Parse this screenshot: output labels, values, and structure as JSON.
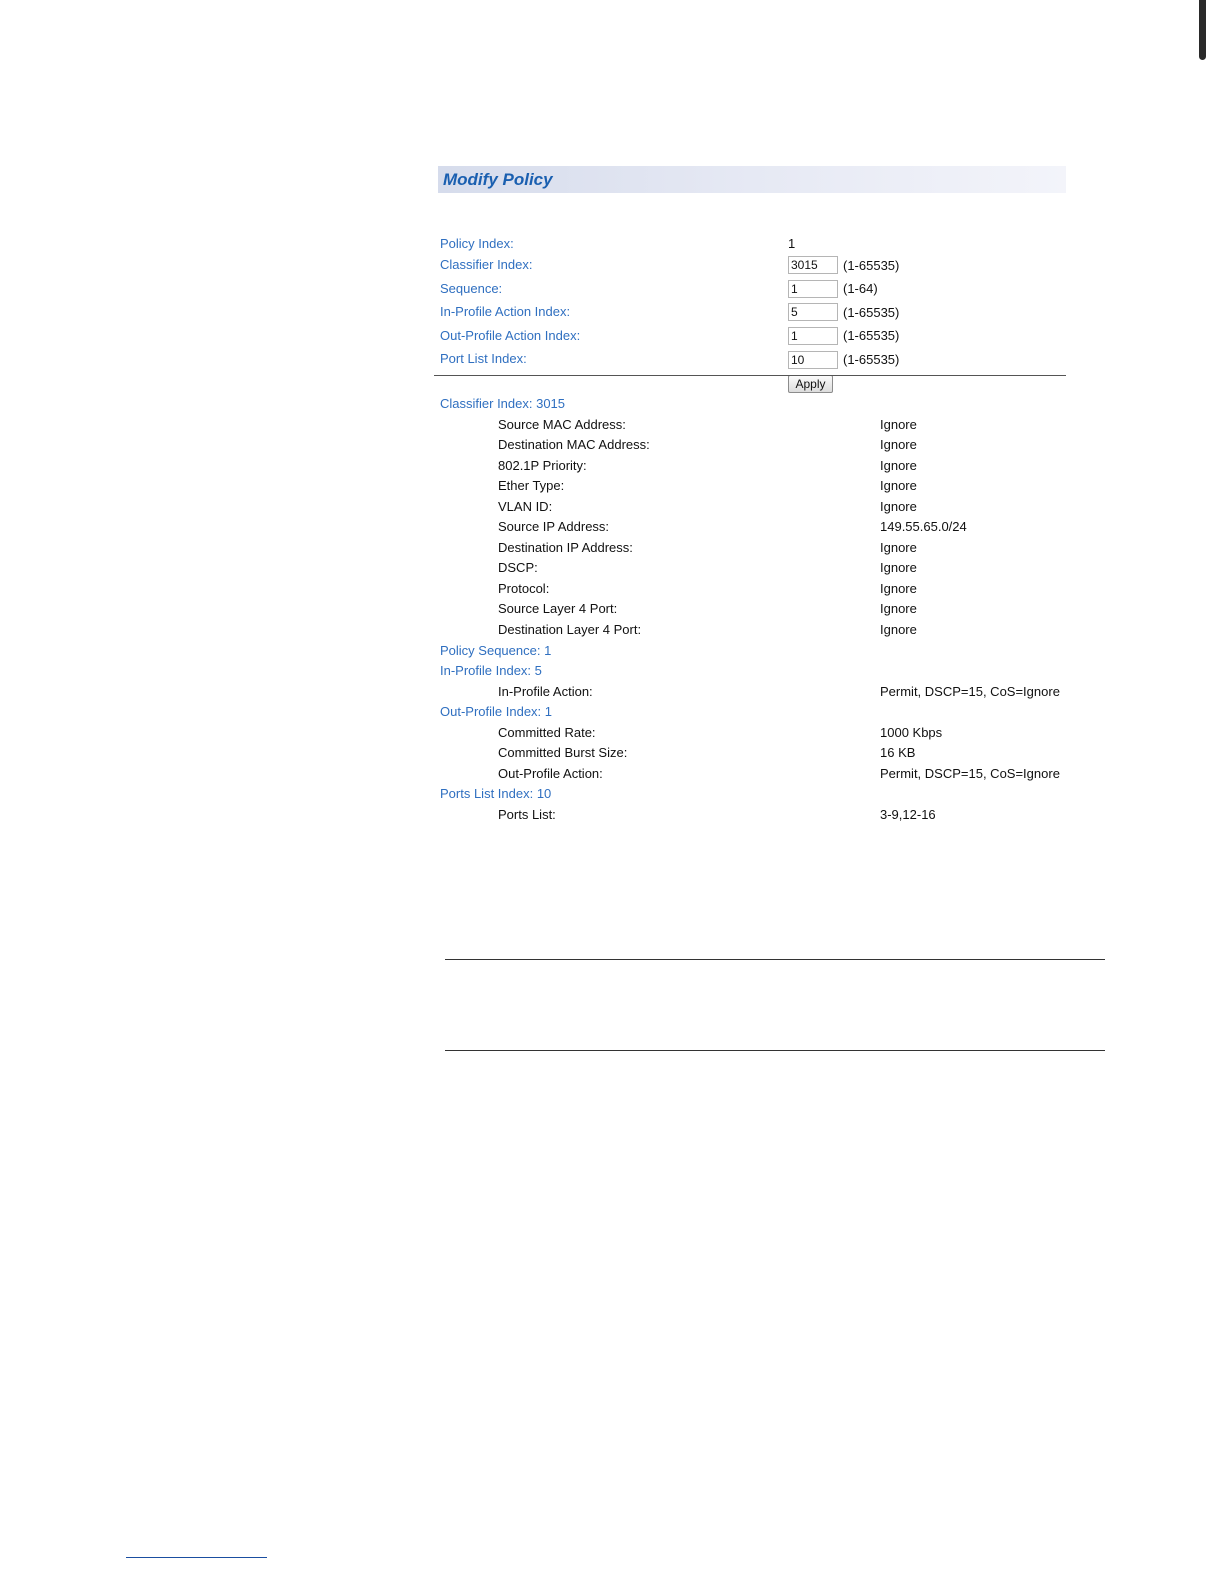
{
  "panel": {
    "title": "Modify Policy"
  },
  "form": {
    "policy_index": {
      "label": "Policy Index:",
      "value": "1"
    },
    "classifier_index": {
      "label": "Classifier Index:",
      "value": "3015",
      "range": "(1-65535)"
    },
    "sequence": {
      "label": "Sequence:",
      "value": "1",
      "range": "(1-64)"
    },
    "in_profile_action_index": {
      "label": "In-Profile Action Index:",
      "value": "5",
      "range": "(1-65535)"
    },
    "out_profile_action_index": {
      "label": "Out-Profile Action Index:",
      "value": "1",
      "range": "(1-65535)"
    },
    "port_list_index": {
      "label": "Port List Index:",
      "value": "10",
      "range": "(1-65535)"
    },
    "apply_label": "Apply"
  },
  "details": {
    "classifier": {
      "header": "Classifier Index: 3015",
      "rows": [
        {
          "key": "Source MAC Address:",
          "value": "Ignore"
        },
        {
          "key": "Destination MAC Address:",
          "value": "Ignore"
        },
        {
          "key": "802.1P Priority:",
          "value": "Ignore"
        },
        {
          "key": "Ether Type:",
          "value": "Ignore"
        },
        {
          "key": "VLAN ID:",
          "value": "Ignore"
        },
        {
          "key": "Source IP Address:",
          "value": "149.55.65.0/24"
        },
        {
          "key": "Destination IP Address:",
          "value": "Ignore"
        },
        {
          "key": "DSCP:",
          "value": "Ignore"
        },
        {
          "key": "Protocol:",
          "value": "Ignore"
        },
        {
          "key": "Source Layer 4 Port:",
          "value": "Ignore"
        },
        {
          "key": "Destination Layer 4 Port:",
          "value": "Ignore"
        }
      ]
    },
    "policy_sequence": {
      "header": "Policy Sequence: 1"
    },
    "in_profile": {
      "header": "In-Profile Index: 5",
      "rows": [
        {
          "key": "In-Profile Action:",
          "value": "Permit, DSCP=15, CoS=Ignore"
        }
      ]
    },
    "out_profile": {
      "header": "Out-Profile Index: 1",
      "rows": [
        {
          "key": "Committed Rate:",
          "value": "1000 Kbps"
        },
        {
          "key": "Committed Burst Size:",
          "value": "16 KB"
        },
        {
          "key": "Out-Profile Action:",
          "value": "Permit, DSCP=15, CoS=Ignore"
        }
      ]
    },
    "ports_list": {
      "header": "Ports List Index: 10",
      "rows": [
        {
          "key": "Ports List:",
          "value": "3-9,12-16"
        }
      ]
    }
  }
}
